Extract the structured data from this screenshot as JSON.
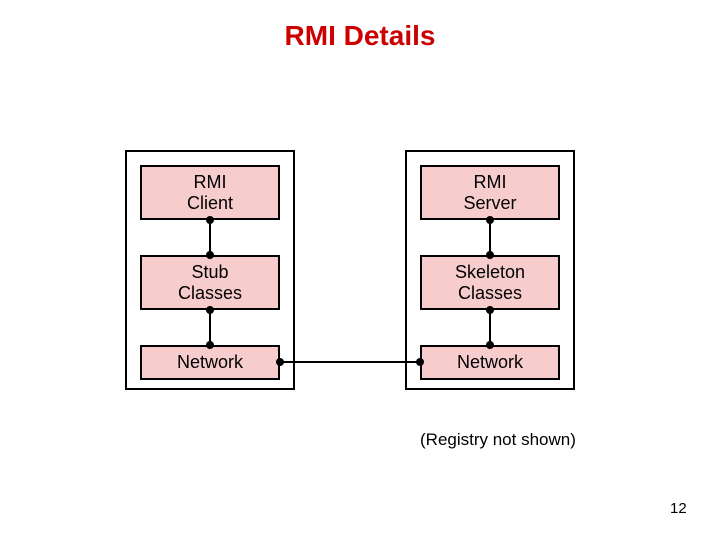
{
  "title": "RMI Details",
  "left": {
    "top": "RMI\nClient",
    "mid": "Stub\nClasses",
    "bot": "Network"
  },
  "right": {
    "top": "RMI\nServer",
    "mid": "Skeleton\nClasses",
    "bot": "Network"
  },
  "note": "(Registry not shown)",
  "page": "12",
  "colors": {
    "title": "#cc0000",
    "box_fill": "#f7cccc",
    "line": "#000000"
  }
}
